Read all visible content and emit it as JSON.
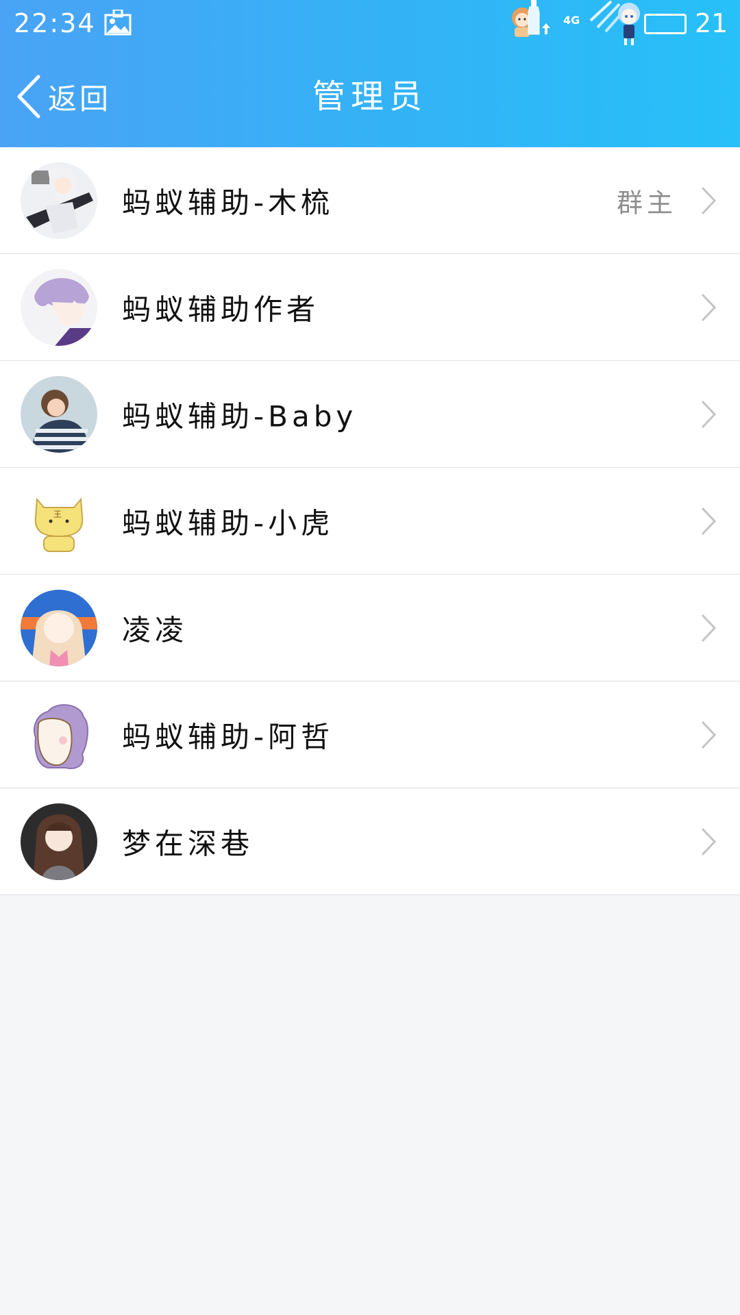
{
  "status_bar": {
    "time": "22:34",
    "network": "4G",
    "battery": "21"
  },
  "nav": {
    "back_label": "返回",
    "title": "管理员"
  },
  "members": [
    {
      "name": "蚂蚁辅助-木梳",
      "role": "群主",
      "avatar": "anime-boy-white-hair-avatar"
    },
    {
      "name": "蚂蚁辅助作者",
      "role": "",
      "avatar": "anime-boy-purple-hair-avatar"
    },
    {
      "name": "蚂蚁辅助-Baby",
      "role": "",
      "avatar": "girl-striped-sweater-avatar"
    },
    {
      "name": "蚂蚁辅助-小虎",
      "role": "",
      "avatar": "cartoon-tiger-avatar"
    },
    {
      "name": "凌凌",
      "role": "",
      "avatar": "anime-girl-twintails-avatar"
    },
    {
      "name": "蚂蚁辅助-阿哲",
      "role": "",
      "avatar": "cartoon-sheep-avatar"
    },
    {
      "name": "梦在深巷",
      "role": "",
      "avatar": "anime-girl-brown-hair-avatar"
    }
  ],
  "colors": {
    "header_start": "#4aa3f5",
    "header_end": "#27c0f8",
    "background": "#f5f6f8",
    "divider": "#dcdee2",
    "role_text": "#8e8e8e",
    "chevron": "#c4c4c4"
  }
}
